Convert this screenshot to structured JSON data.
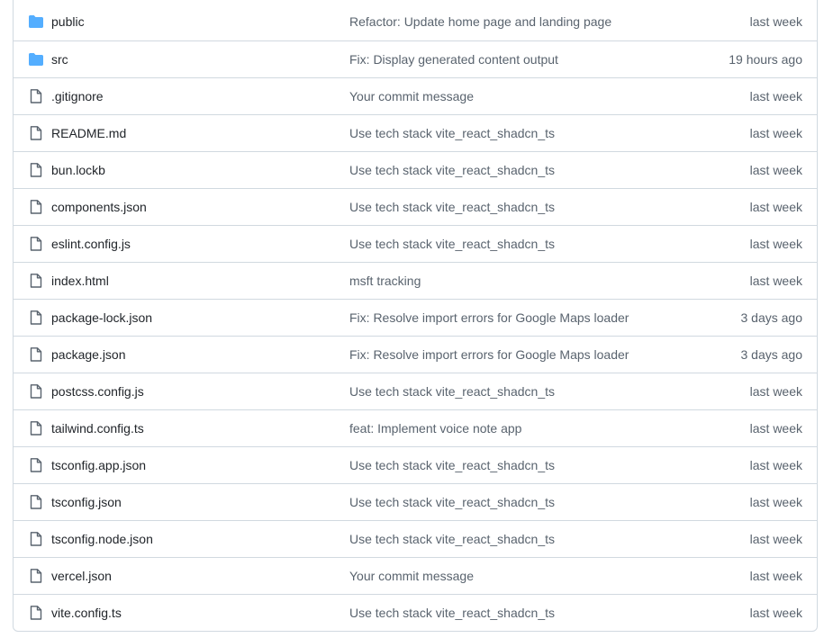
{
  "colors": {
    "folder": "#54aeff",
    "file_icon": "#59636e",
    "border": "#d1d9e0",
    "text": "#1f2328",
    "muted": "#59636e"
  },
  "files": [
    {
      "type": "folder",
      "icon": "folder-icon",
      "name": "public",
      "commit": "Refactor: Update home page and landing page",
      "age": "last week"
    },
    {
      "type": "folder",
      "icon": "folder-icon",
      "name": "src",
      "commit": "Fix: Display generated content output",
      "age": "19 hours ago"
    },
    {
      "type": "file",
      "icon": "file-icon",
      "name": ".gitignore",
      "commit": "Your commit message",
      "age": "last week"
    },
    {
      "type": "file",
      "icon": "file-icon",
      "name": "README.md",
      "commit": "Use tech stack vite_react_shadcn_ts",
      "age": "last week"
    },
    {
      "type": "file",
      "icon": "file-icon",
      "name": "bun.lockb",
      "commit": "Use tech stack vite_react_shadcn_ts",
      "age": "last week"
    },
    {
      "type": "file",
      "icon": "file-icon",
      "name": "components.json",
      "commit": "Use tech stack vite_react_shadcn_ts",
      "age": "last week"
    },
    {
      "type": "file",
      "icon": "file-icon",
      "name": "eslint.config.js",
      "commit": "Use tech stack vite_react_shadcn_ts",
      "age": "last week"
    },
    {
      "type": "file",
      "icon": "file-icon",
      "name": "index.html",
      "commit": "msft tracking",
      "age": "last week"
    },
    {
      "type": "file",
      "icon": "file-icon",
      "name": "package-lock.json",
      "commit": "Fix: Resolve import errors for Google Maps loader",
      "age": "3 days ago"
    },
    {
      "type": "file",
      "icon": "file-icon",
      "name": "package.json",
      "commit": "Fix: Resolve import errors for Google Maps loader",
      "age": "3 days ago"
    },
    {
      "type": "file",
      "icon": "file-icon",
      "name": "postcss.config.js",
      "commit": "Use tech stack vite_react_shadcn_ts",
      "age": "last week"
    },
    {
      "type": "file",
      "icon": "file-icon",
      "name": "tailwind.config.ts",
      "commit": "feat: Implement voice note app",
      "age": "last week"
    },
    {
      "type": "file",
      "icon": "file-icon",
      "name": "tsconfig.app.json",
      "commit": "Use tech stack vite_react_shadcn_ts",
      "age": "last week"
    },
    {
      "type": "file",
      "icon": "file-icon",
      "name": "tsconfig.json",
      "commit": "Use tech stack vite_react_shadcn_ts",
      "age": "last week"
    },
    {
      "type": "file",
      "icon": "file-icon",
      "name": "tsconfig.node.json",
      "commit": "Use tech stack vite_react_shadcn_ts",
      "age": "last week"
    },
    {
      "type": "file",
      "icon": "file-icon",
      "name": "vercel.json",
      "commit": "Your commit message",
      "age": "last week"
    },
    {
      "type": "file",
      "icon": "file-icon",
      "name": "vite.config.ts",
      "commit": "Use tech stack vite_react_shadcn_ts",
      "age": "last week"
    }
  ]
}
